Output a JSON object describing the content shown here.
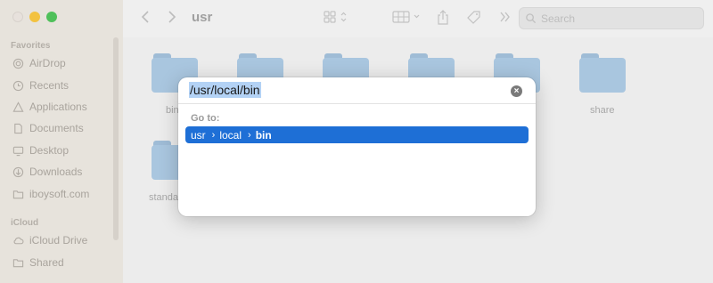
{
  "toolbar": {
    "title": "usr",
    "search_placeholder": "Search"
  },
  "sidebar": {
    "favorites_header": "Favorites",
    "favorites": [
      {
        "label": "AirDrop",
        "icon": "airdrop-icon"
      },
      {
        "label": "Recents",
        "icon": "clock-icon"
      },
      {
        "label": "Applications",
        "icon": "applications-icon"
      },
      {
        "label": "Documents",
        "icon": "document-icon"
      },
      {
        "label": "Desktop",
        "icon": "desktop-icon"
      },
      {
        "label": "Downloads",
        "icon": "download-icon"
      },
      {
        "label": "iboysoft.com",
        "icon": "folder-icon"
      }
    ],
    "icloud_header": "iCloud",
    "icloud": [
      {
        "label": "iCloud Drive",
        "icon": "cloud-icon"
      },
      {
        "label": "Shared",
        "icon": "shared-folder-icon"
      }
    ]
  },
  "folders": [
    {
      "label": "bin"
    },
    {
      "label": ""
    },
    {
      "label": ""
    },
    {
      "label": ""
    },
    {
      "label": ""
    },
    {
      "label": "share"
    },
    {
      "label": "standa"
    }
  ],
  "goto_sheet": {
    "path_value": "/usr/local/bin",
    "goto_label": "Go to:",
    "suggestion": {
      "segments": [
        "usr",
        "local",
        "bin"
      ]
    }
  },
  "colors": {
    "accent": "#1e6fd6",
    "selection": "#b3d2f5",
    "folder": "#a9c6df"
  }
}
